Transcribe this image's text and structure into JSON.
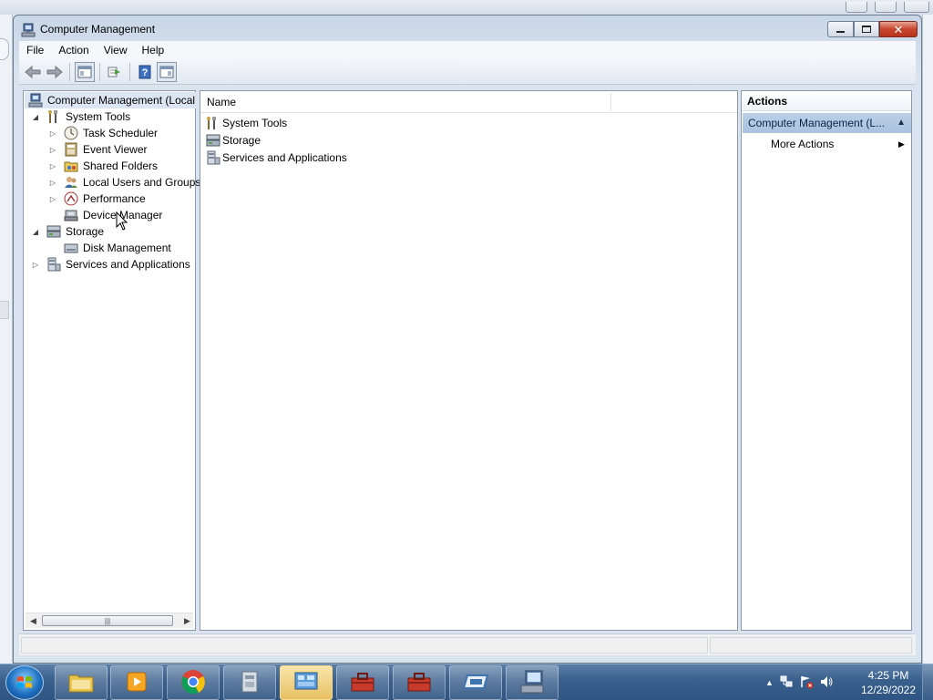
{
  "window": {
    "title": "Computer Management",
    "menu": [
      "File",
      "Action",
      "View",
      "Help"
    ]
  },
  "tree": {
    "root": "Computer Management (Local",
    "system_tools": "System Tools",
    "task_scheduler": "Task Scheduler",
    "event_viewer": "Event Viewer",
    "shared_folders": "Shared Folders",
    "local_users_groups": "Local Users and Groups",
    "performance": "Performance",
    "device_manager": "Device Manager",
    "storage": "Storage",
    "disk_management": "Disk Management",
    "services_apps": "Services and Applications"
  },
  "list": {
    "column_name": "Name",
    "items": [
      "System Tools",
      "Storage",
      "Services and Applications"
    ]
  },
  "actions": {
    "header": "Actions",
    "section": "Computer Management (L...",
    "more_actions": "More Actions"
  },
  "taskbar": {
    "time": "4:25 PM",
    "date": "12/29/2022"
  },
  "icons": {
    "title": "computer-management-icon",
    "back": "back-arrow-icon",
    "forward": "forward-arrow-icon",
    "help": "help-icon"
  }
}
